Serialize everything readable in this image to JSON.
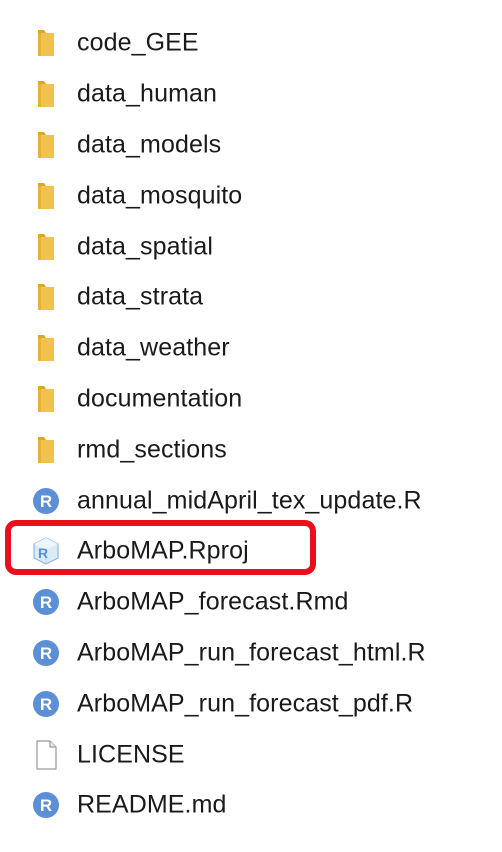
{
  "files": [
    {
      "name": "code_GEE",
      "icon": "folder-icon"
    },
    {
      "name": "data_human",
      "icon": "folder-icon"
    },
    {
      "name": "data_models",
      "icon": "folder-icon"
    },
    {
      "name": "data_mosquito",
      "icon": "folder-icon"
    },
    {
      "name": "data_spatial",
      "icon": "folder-icon"
    },
    {
      "name": "data_strata",
      "icon": "folder-icon"
    },
    {
      "name": "data_weather",
      "icon": "folder-icon"
    },
    {
      "name": "documentation",
      "icon": "folder-icon"
    },
    {
      "name": "rmd_sections",
      "icon": "folder-icon"
    },
    {
      "name": "annual_midApril_tex_update.R",
      "icon": "r-file-icon"
    },
    {
      "name": "ArboMAP.Rproj",
      "icon": "rproj-file-icon"
    },
    {
      "name": "ArboMAP_forecast.Rmd",
      "icon": "r-file-icon"
    },
    {
      "name": "ArboMAP_run_forecast_html.R",
      "icon": "r-file-icon"
    },
    {
      "name": "ArboMAP_run_forecast_pdf.R",
      "icon": "r-file-icon"
    },
    {
      "name": "LICENSE",
      "icon": "blank-file-icon"
    },
    {
      "name": "README.md",
      "icon": "r-file-icon"
    }
  ],
  "icon_glyphs": {
    "r_letter": "R"
  },
  "colors": {
    "folder": "#f2c14e",
    "folder_dark": "#dba726",
    "r_icon": "#5b8fd6",
    "highlight": "#e8101c"
  }
}
